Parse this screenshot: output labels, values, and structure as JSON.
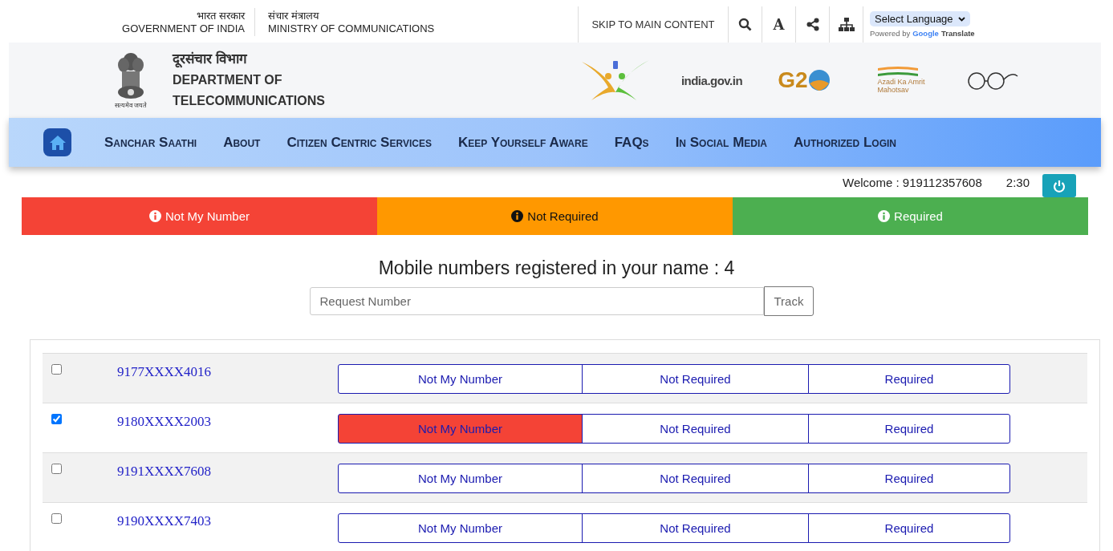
{
  "top_bar": {
    "gov_hindi": "भारत सरकार",
    "gov": "GOVERNMENT OF INDIA",
    "ministry_hindi": "संचार मंत्रालय",
    "ministry": "MINISTRY OF COMMUNICATIONS",
    "skip_link": "SKIP TO MAIN CONTENT",
    "font_button": "A",
    "language_select": "Select Language",
    "powered_by": "Powered by",
    "google": "Google",
    "translate": "Translate"
  },
  "header": {
    "title_hindi": "दूरसंचार विभाग",
    "title_line_1": "DEPARTMENT OF",
    "title_line_2": "TELECOMMUNICATIONS",
    "emblem_motto": "सत्यमेव जयते",
    "logos": [
      {
        "kind": "saathi"
      },
      {
        "kind": "indiagov",
        "text": "india.gov.in"
      },
      {
        "kind": "g20",
        "text": "G2"
      },
      {
        "kind": "azadi",
        "text": "Azadi Ka Amrit Mahotsav"
      },
      {
        "kind": "glasses"
      }
    ]
  },
  "nav": {
    "items": [
      "Sanchar Saathi",
      "About",
      "Citizen Centric Services",
      "Keep Yourself Aware",
      "FAQs",
      "In Social Media",
      "Authorized Login"
    ]
  },
  "session": {
    "welcome": "Welcome : 919112357608",
    "timer": "2:30"
  },
  "legend": [
    {
      "label": "Not My Number",
      "color": "#f44336"
    },
    {
      "label": "Not Required",
      "color": "#ff9800"
    },
    {
      "label": "Required",
      "color": "#4caf50"
    }
  ],
  "heading": "Mobile numbers registered in your name : 4",
  "search": {
    "placeholder": "Request Number",
    "button": "Track"
  },
  "rows": [
    {
      "number": "9177XXXX4016",
      "checked": false,
      "options": [
        {
          "label": "Not My Number",
          "selected": false
        },
        {
          "label": "Not Required",
          "selected": false
        },
        {
          "label": "Required",
          "selected": false
        }
      ]
    },
    {
      "number": "9180XXXX2003",
      "checked": true,
      "options": [
        {
          "label": "Not My Number",
          "selected": true
        },
        {
          "label": "Not Required",
          "selected": false
        },
        {
          "label": "Required",
          "selected": false
        }
      ]
    },
    {
      "number": "9191XXXX7608",
      "checked": false,
      "options": [
        {
          "label": "Not My Number",
          "selected": false
        },
        {
          "label": "Not Required",
          "selected": false
        },
        {
          "label": "Required",
          "selected": false
        }
      ]
    },
    {
      "number": "9190XXXX7403",
      "checked": false,
      "options": [
        {
          "label": "Not My Number",
          "selected": false
        },
        {
          "label": "Not Required",
          "selected": false
        },
        {
          "label": "Required",
          "selected": false
        }
      ]
    }
  ]
}
